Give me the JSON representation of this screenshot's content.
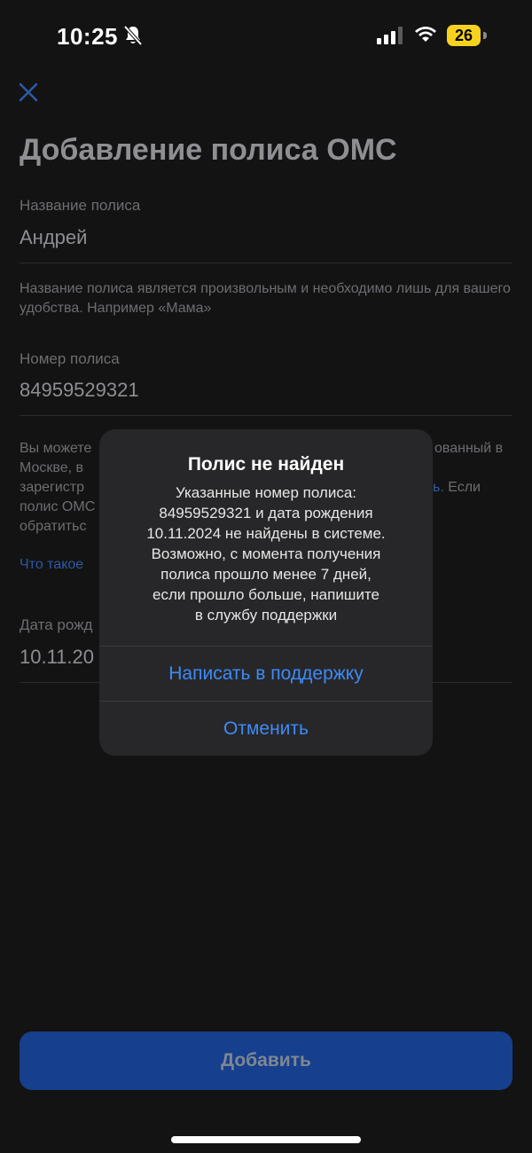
{
  "status_bar": {
    "time": "10:25",
    "battery_level": "26",
    "battery_color": "#f6d21e"
  },
  "page": {
    "title": "Добавление полиса ОМС",
    "name_field": {
      "label": "Название полиса",
      "value": "Андрей",
      "hint": "Название полиса является произвольным и необходимо лишь для вашего удобства. Например «Мама»"
    },
    "number_field": {
      "label": "Номер полиса",
      "value": "84959529321",
      "hint_lines": [
        {
          "left": "Вы можете",
          "right": "ованный в"
        },
        {
          "left": "Москве, в",
          "right": ""
        },
        {
          "left": "зарегистр",
          "right_link": "ь.",
          "right": " Если"
        },
        {
          "left": "полис ОМС",
          "right": ""
        },
        {
          "left": "обратитьс",
          "right": ""
        }
      ],
      "link": "Что такое"
    },
    "birth_field": {
      "label": "Дата рожд",
      "value": "10.11.20"
    },
    "add_button": "Добавить"
  },
  "alert": {
    "title": "Полис не найден",
    "message_lines": [
      "Указанные номер полиса:",
      "84959529321 и дата рождения",
      "10.11.2024 не найдены в системе.",
      "Возможно, с момента получения",
      "полиса прошло менее 7 дней,",
      "если прошло больше, напишите",
      "в службу поддержки"
    ],
    "primary_action": "Написать в поддержку",
    "cancel_action": "Отменить"
  },
  "colors": {
    "accent": "#3d8bf7",
    "button": "#163f8d",
    "background": "#131313"
  }
}
